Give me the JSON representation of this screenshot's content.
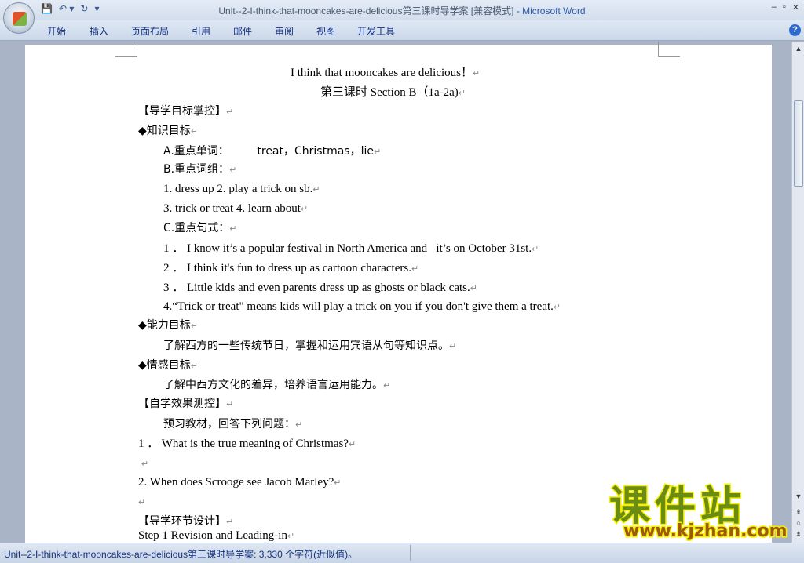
{
  "window": {
    "title": "Unit--2-I-think-that-mooncakes-are-delicious第三课时导学案 [兼容模式]",
    "app": " - Microsoft Word",
    "controls": [
      "–",
      "▫",
      "✕"
    ]
  },
  "qat": [
    "💾",
    "↶ ▾",
    "↻",
    "▾"
  ],
  "ribbon": {
    "tabs": [
      "开始",
      "插入",
      "页面布局",
      "引用",
      "邮件",
      "审阅",
      "视图",
      "开发工具"
    ],
    "help": "?"
  },
  "document": {
    "lines": [
      "I think that mooncakes are delicious！",
      "第三课时 Section B（1a-2a)",
      "【导学目标掌控】",
      "◆知识目标",
      "A.重点单词：        treat，Christmas，lie",
      "B.重点词组：",
      "1. dress up 2. play a trick on sb.",
      "3. trick or treat 4. learn about",
      "C.重点句式：",
      "1 ． I know it’s a popular festival in North America and   it’s on October 31st.",
      "2 ． I think it's fun to dress up as cartoon characters.",
      "3 ． Little kids and even parents dress up as ghosts or black cats.",
      "4.“Trick or treat\" means kids will play a trick on you if you don't give them a treat.",
      "◆能力目标",
      "了解西方的一些传统节日，掌握和运用宾语从句等知识点。",
      "◆情感目标",
      "了解中西方文化的差异，培养语言运用能力。",
      "【自学效果测控】",
      "预习教材，回答下列问题：",
      "1 ． What is the true meaning of Christmas?",
      "",
      "2. When does Scrooge see Jacob Marley?",
      "",
      "【导学环节设计】",
      "Step 1 Revision and Leading-in"
    ],
    "para_mark": "↵"
  },
  "status": {
    "text": "Unit--2-I-think-that-mooncakes-are-delicious第三课时导学案: 3,330 个字符(近似值)。"
  },
  "watermark": {
    "cn": "课件站",
    "url": "www.kjzhan.com"
  }
}
